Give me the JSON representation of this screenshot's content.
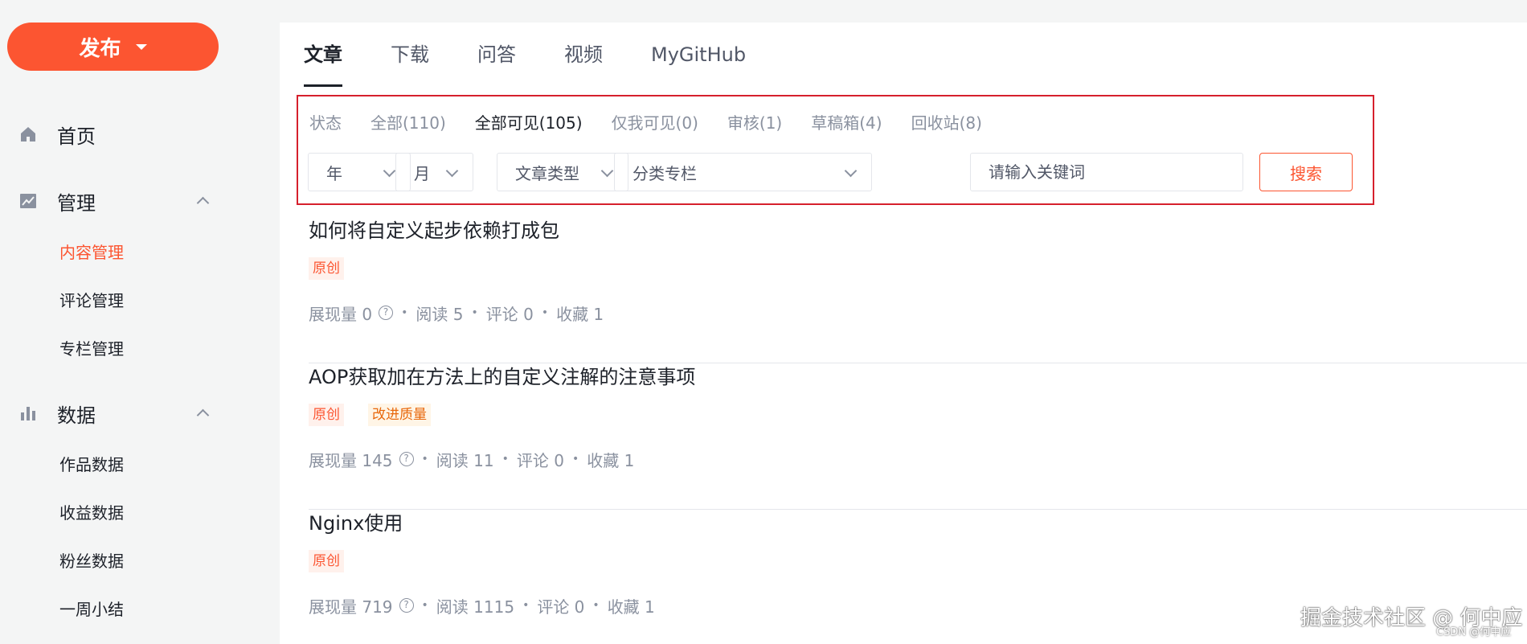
{
  "sidebar": {
    "publish_label": "发布",
    "home_label": "首页",
    "manage_label": "管理",
    "manage_items": [
      "内容管理",
      "评论管理",
      "专栏管理"
    ],
    "data_label": "数据",
    "data_items": [
      "作品数据",
      "收益数据",
      "粉丝数据",
      "一周小结"
    ]
  },
  "tabs": [
    "文章",
    "下载",
    "问答",
    "视频",
    "MyGitHub"
  ],
  "filter": {
    "status_label": "状态",
    "status_items": [
      "全部(110)",
      "全部可见(105)",
      "仅我可见(0)",
      "审核(1)",
      "草稿箱(4)",
      "回收站(8)"
    ],
    "year": "年",
    "month": "月",
    "type": "文章类型",
    "category": "分类专栏",
    "keyword_placeholder": "请输入关键词",
    "search_label": "搜索"
  },
  "articles": [
    {
      "title": "如何将自定义起步依赖打成包",
      "tags": [
        "原创"
      ],
      "views": "展现量 0",
      "reads": "阅读 5",
      "comments": "评论 0",
      "favorites": "收藏 1"
    },
    {
      "title": "AOP获取加在方法上的自定义注解的注意事项",
      "tags": [
        "原创",
        "改进质量"
      ],
      "views": "展现量 145",
      "reads": "阅读 11",
      "comments": "评论 0",
      "favorites": "收藏 1"
    },
    {
      "title": "Nginx使用",
      "tags": [
        "原创"
      ],
      "views": "展现量 719",
      "reads": "阅读 1115",
      "comments": "评论 0",
      "favorites": "收藏 1"
    }
  ],
  "help_glyph": "?",
  "meta_separator": "•",
  "watermark": "掘金技术社区 @ 何中应",
  "watermark_small": "CSDN @何中应",
  "colors": {
    "accent": "#fc5531",
    "highlight_border": "#d6202d"
  },
  "icons": {
    "home": "home-icon",
    "manage": "chart-line-icon",
    "data": "bar-chart-icon"
  }
}
